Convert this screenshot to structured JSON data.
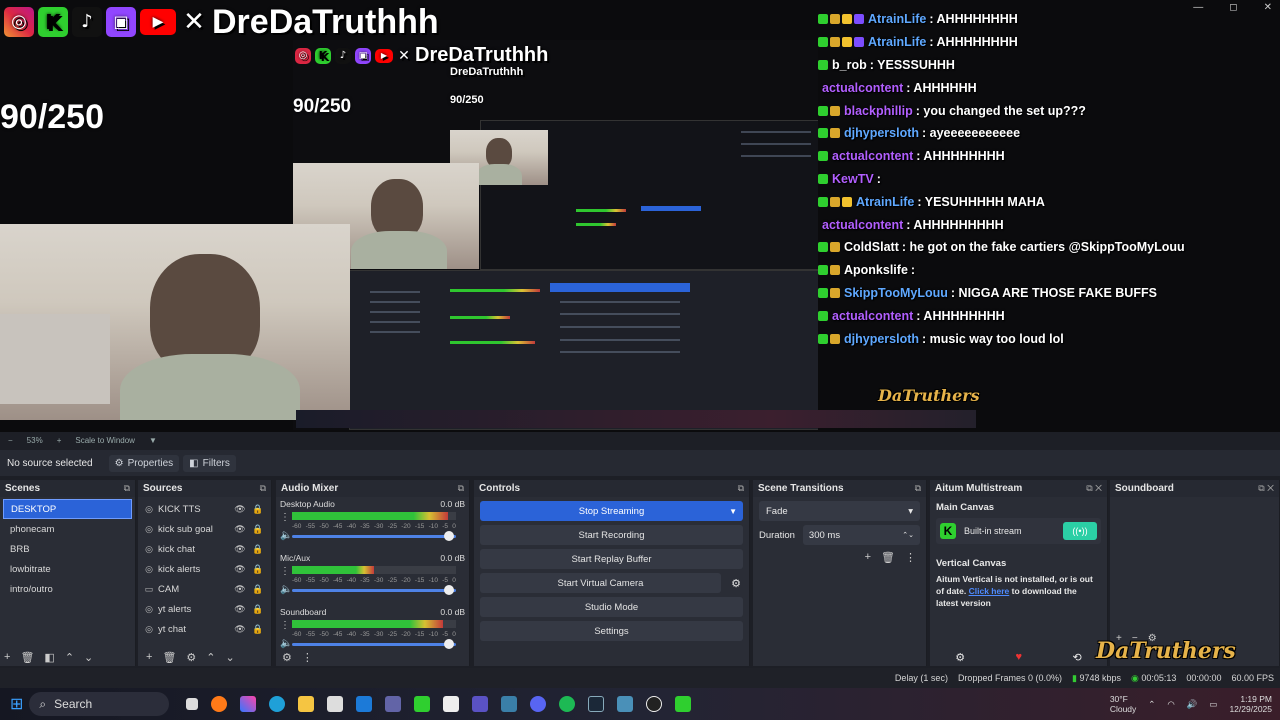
{
  "window": {
    "min": "—",
    "max": "◻",
    "close": "✕"
  },
  "overlay": {
    "handle": "DreDaTruthhh",
    "counter": "90/250",
    "logo": "DaTruthers"
  },
  "chat": [
    {
      "user": "AtrainLife",
      "msg": ": AHHHHHHHH",
      "color": "#5fa8ff",
      "badges": [
        "#2fcf2f",
        "#d9a72b",
        "#f2c22e",
        "#7c4dff"
      ]
    },
    {
      "user": "AtrainLife",
      "msg": ": AHHHHHHHH",
      "color": "#5fa8ff",
      "badges": [
        "#2fcf2f",
        "#d9a72b",
        "#f2c22e",
        "#7c4dff"
      ]
    },
    {
      "user": "b_rob",
      "msg": ": YESSSUHHH",
      "color": "#ffffff",
      "badges": [
        "#2fcf2f"
      ]
    },
    {
      "user": "actualcontent",
      "msg": ": AHHHHHH",
      "color": "#b25fff",
      "badges": []
    },
    {
      "user": "blackphillip",
      "msg": ": you changed the set up???",
      "color": "#b25fff",
      "badges": [
        "#2fcf2f",
        "#d9a72b"
      ]
    },
    {
      "user": "djhypersloth",
      "msg": ": ayeeeeeeeeeee",
      "color": "#5fa8ff",
      "badges": [
        "#2fcf2f",
        "#d9a72b"
      ]
    },
    {
      "user": "actualcontent",
      "msg": ": AHHHHHHHH",
      "color": "#b25fff",
      "badges": [
        "#2fcf2f"
      ]
    },
    {
      "user": "KewTV",
      "msg": ":",
      "color": "#b25fff",
      "badges": [
        "#2fcf2f"
      ]
    },
    {
      "user": "AtrainLife",
      "msg": ": YESUHHHHH MAHA",
      "color": "#5fa8ff",
      "badges": [
        "#2fcf2f",
        "#d9a72b",
        "#f2c22e"
      ]
    },
    {
      "user": "actualcontent",
      "msg": ": AHHHHHHHHH",
      "color": "#b25fff",
      "badges": []
    },
    {
      "user": "ColdSlatt",
      "msg": ": he got on the fake cartiers @SkippTooMyLouu",
      "color": "#ffffff",
      "badges": [
        "#2fcf2f",
        "#d9a72b"
      ]
    },
    {
      "user": "Aponkslife",
      "msg": ":",
      "color": "#ffffff",
      "badges": [
        "#2fcf2f",
        "#d9a72b"
      ]
    },
    {
      "user": "SkippTooMyLouu",
      "msg": ": NIGGA ARE THOSE FAKE BUFFS",
      "color": "#5fa8ff",
      "badges": [
        "#2fcf2f",
        "#d9a72b"
      ]
    },
    {
      "user": "actualcontent",
      "msg": ": AHHHHHHHH",
      "color": "#b25fff",
      "badges": [
        "#2fcf2f"
      ]
    },
    {
      "user": "djhypersloth",
      "msg": ": music way too loud lol",
      "color": "#5fa8ff",
      "badges": [
        "#2fcf2f",
        "#d9a72b"
      ]
    }
  ],
  "zoombar": {
    "zoom": "53%",
    "plus": "+",
    "scale": "Scale to Window"
  },
  "sourcebar": {
    "none": "No source selected",
    "properties": "Properties",
    "filters": "Filters"
  },
  "scenes": {
    "title": "Scenes",
    "items": [
      "DESKTOP",
      "phonecam",
      "BRB",
      "lowbitrate",
      "intro/outro"
    ]
  },
  "sources": {
    "title": "Sources",
    "items": [
      "KICK TTS",
      "kick sub goal",
      "kick chat",
      "kick alerts",
      "CAM",
      "yt alerts",
      "yt chat"
    ]
  },
  "mixer": {
    "title": "Audio Mixer",
    "channels": [
      {
        "name": "Desktop Audio",
        "db": "0.0 dB",
        "level": 0.95
      },
      {
        "name": "Mic/Aux",
        "db": "0.0 dB",
        "level": 0.5
      },
      {
        "name": "Soundboard",
        "db": "0.0 dB",
        "level": 0.92
      }
    ],
    "scale": [
      "-60",
      "-55",
      "-50",
      "-45",
      "-40",
      "-35",
      "-30",
      "-25",
      "-20",
      "-15",
      "-10",
      "-5",
      "0"
    ]
  },
  "controls": {
    "title": "Controls",
    "stop_streaming": "Stop Streaming",
    "start_recording": "Start Recording",
    "start_replay": "Start Replay Buffer",
    "start_virtual": "Start Virtual Camera",
    "studio_mode": "Studio Mode",
    "settings": "Settings"
  },
  "transitions": {
    "title": "Scene Transitions",
    "selected": "Fade",
    "duration_label": "Duration",
    "duration": "300 ms"
  },
  "aitum": {
    "title": "Aitum Multistream",
    "main_canvas": "Main Canvas",
    "builtin": "Built-in stream",
    "vertical_canvas": "Vertical Canvas",
    "warning": "Aitum Vertical is not installed, or is out of date.",
    "link": "Click here",
    "link_rest": "to download the latest version"
  },
  "soundboard": {
    "title": "Soundboard"
  },
  "status": {
    "delay": "Delay (1 sec)",
    "dropped": "Dropped Frames 0 (0.0%)",
    "kbps": "9748 kbps",
    "time1": "00:05:13",
    "time2": "00:00:00 / 60.00 FPS",
    "time3": "00:00:00",
    "fps": "60.00 FPS"
  },
  "taskbar": {
    "search": "Search",
    "weather_temp": "30°F",
    "weather_desc": "Cloudy",
    "time": "1:19 PM",
    "date": "12/29/2025"
  },
  "colors": {
    "accent": "#2b63d8",
    "panel": "#2a2d36",
    "bg": "#1d1f26"
  }
}
